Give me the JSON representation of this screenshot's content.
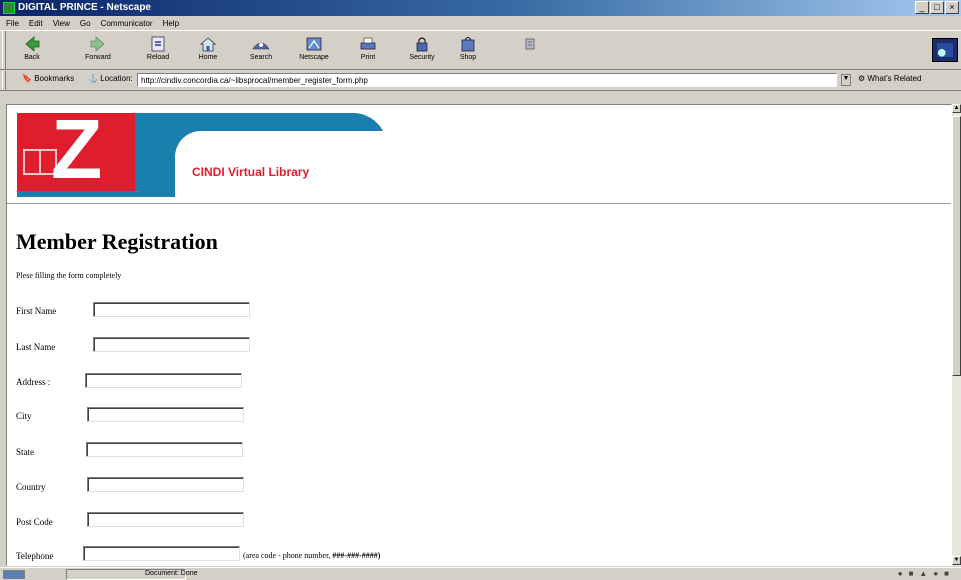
{
  "window": {
    "title": "DIGITAL PRINCE - Netscape",
    "buttons": [
      "_",
      "□",
      "×"
    ]
  },
  "menu": [
    "File",
    "Edit",
    "View",
    "Go",
    "Communicator",
    "Help"
  ],
  "toolbar": {
    "buttons": [
      {
        "label": "Back",
        "icon": "back-arrow-icon"
      },
      {
        "label": "Forward",
        "icon": "forward-arrow-icon"
      },
      {
        "label": "Reload",
        "icon": "reload-icon"
      },
      {
        "label": "Home",
        "icon": "home-icon"
      },
      {
        "label": "Search",
        "icon": "search-icon"
      },
      {
        "label": "Netscape",
        "icon": "netscape-icon"
      },
      {
        "label": "Print",
        "icon": "print-icon"
      },
      {
        "label": "Security",
        "icon": "security-icon"
      },
      {
        "label": "Shop",
        "icon": "shop-icon"
      },
      {
        "label": "",
        "icon": "stop-icon"
      }
    ]
  },
  "location": {
    "bookmarks_label": "Bookmarks",
    "location_label": "Location:",
    "url": "http://cindiv.concordia.ca/~libsprocal/member_register_form.php",
    "related_label": "What's Related"
  },
  "banner": {
    "library_title": "CINDI Virtual Library",
    "logo_letter": "Z"
  },
  "form": {
    "heading": "Member Registration",
    "intro": "Plese filling the form completely",
    "fields": [
      {
        "label": "First Name",
        "value": ""
      },
      {
        "label": "Last Name",
        "value": ""
      },
      {
        "label": "Address :",
        "value": ""
      },
      {
        "label": "City",
        "value": ""
      },
      {
        "label": "State",
        "value": ""
      },
      {
        "label": "Country",
        "value": ""
      },
      {
        "label": "Post Code",
        "value": ""
      },
      {
        "label": "Telephone",
        "value": ""
      }
    ],
    "phone_hint_prefix": "(area code - phone number,",
    "phone_hint_format": "###-###-####)"
  },
  "status": {
    "text": "Document: Done"
  }
}
